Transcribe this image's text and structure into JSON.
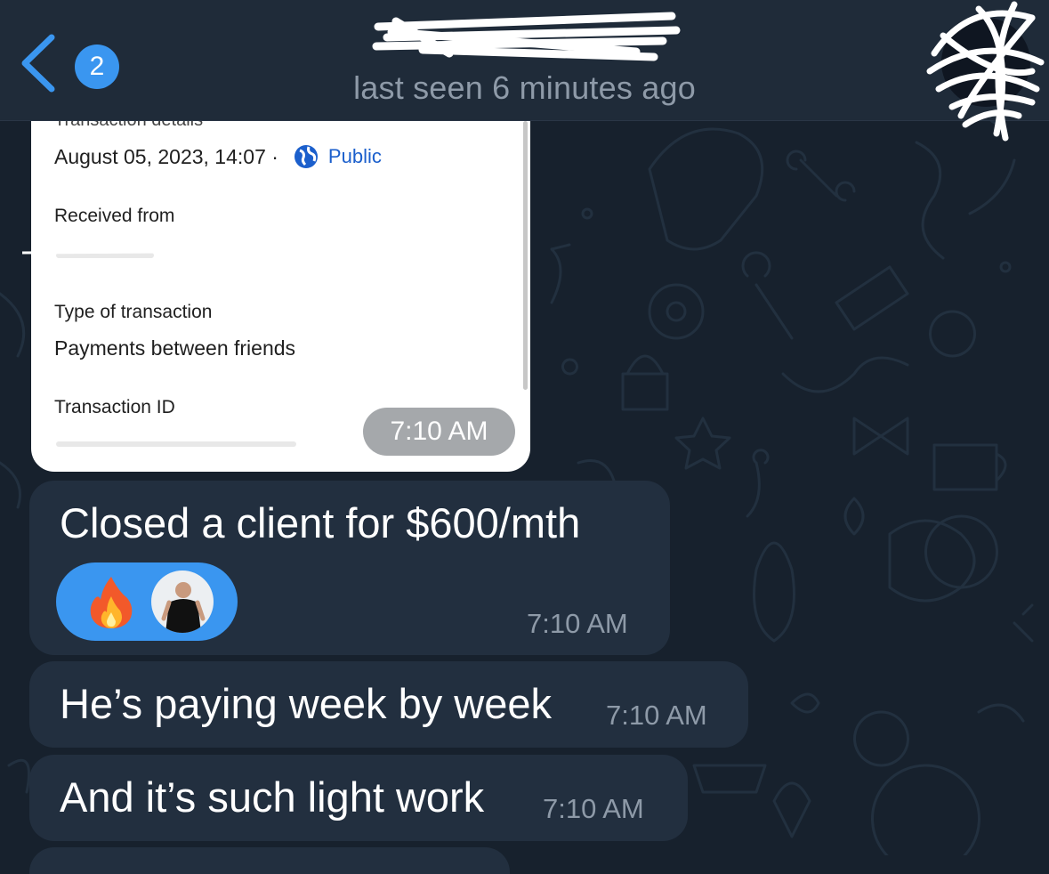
{
  "header": {
    "back_count": "2",
    "status": "last seen 6 minutes ago"
  },
  "transaction_card": {
    "partial_heading": "Transaction details",
    "date": "August 05, 2023, 14:07 ·",
    "visibility": "Public",
    "received_from_label": "Received from",
    "type_label": "Type of transaction",
    "type_value": "Payments between friends",
    "transaction_id_label": "Transaction ID",
    "time": "7:10 AM"
  },
  "messages": [
    {
      "text": "Closed a client for $600/mth",
      "time": "7:10 AM",
      "reaction": "fire-icon"
    },
    {
      "text": "He’s paying week by week",
      "time": "7:10 AM"
    },
    {
      "text": "And it’s such light work",
      "time": "7:10 AM"
    }
  ],
  "colors": {
    "background": "#17212d",
    "header": "#1f2b39",
    "bubble": "#222f3f",
    "accent": "#3a96f0",
    "muted_text": "#8e9aa8"
  }
}
